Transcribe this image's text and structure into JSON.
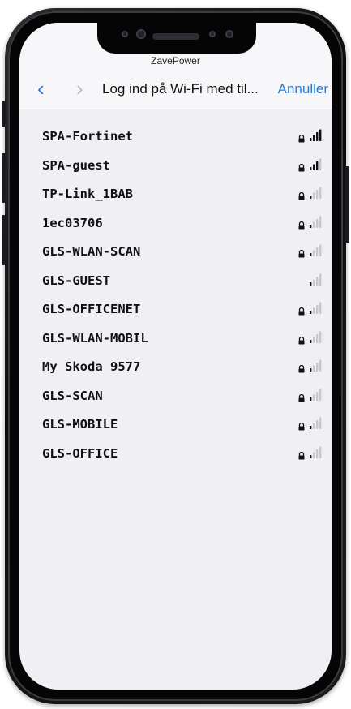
{
  "status": {
    "operator": "ZavePower"
  },
  "nav": {
    "back_icon": "‹",
    "forward_icon": "›",
    "title": "Log ind på Wi-Fi med til...",
    "cancel_label": "Annuller"
  },
  "colors": {
    "accent": "#2a7ad8",
    "background": "#efeff4"
  },
  "networks": [
    {
      "name": "SPA-Fortinet",
      "locked": true,
      "signal": 4
    },
    {
      "name": "SPA-guest",
      "locked": true,
      "signal": 3
    },
    {
      "name": "TP-Link_1BAB",
      "locked": true,
      "signal": 1
    },
    {
      "name": "1ec03706",
      "locked": true,
      "signal": 1
    },
    {
      "name": "GLS-WLAN-SCAN",
      "locked": true,
      "signal": 1
    },
    {
      "name": "GLS-GUEST",
      "locked": false,
      "signal": 1
    },
    {
      "name": "GLS-OFFICENET",
      "locked": true,
      "signal": 1
    },
    {
      "name": "GLS-WLAN-MOBIL",
      "locked": true,
      "signal": 1
    },
    {
      "name": "My Skoda 9577",
      "locked": true,
      "signal": 1
    },
    {
      "name": "GLS-SCAN",
      "locked": true,
      "signal": 1
    },
    {
      "name": "GLS-MOBILE",
      "locked": true,
      "signal": 1
    },
    {
      "name": "GLS-OFFICE",
      "locked": true,
      "signal": 1
    }
  ]
}
